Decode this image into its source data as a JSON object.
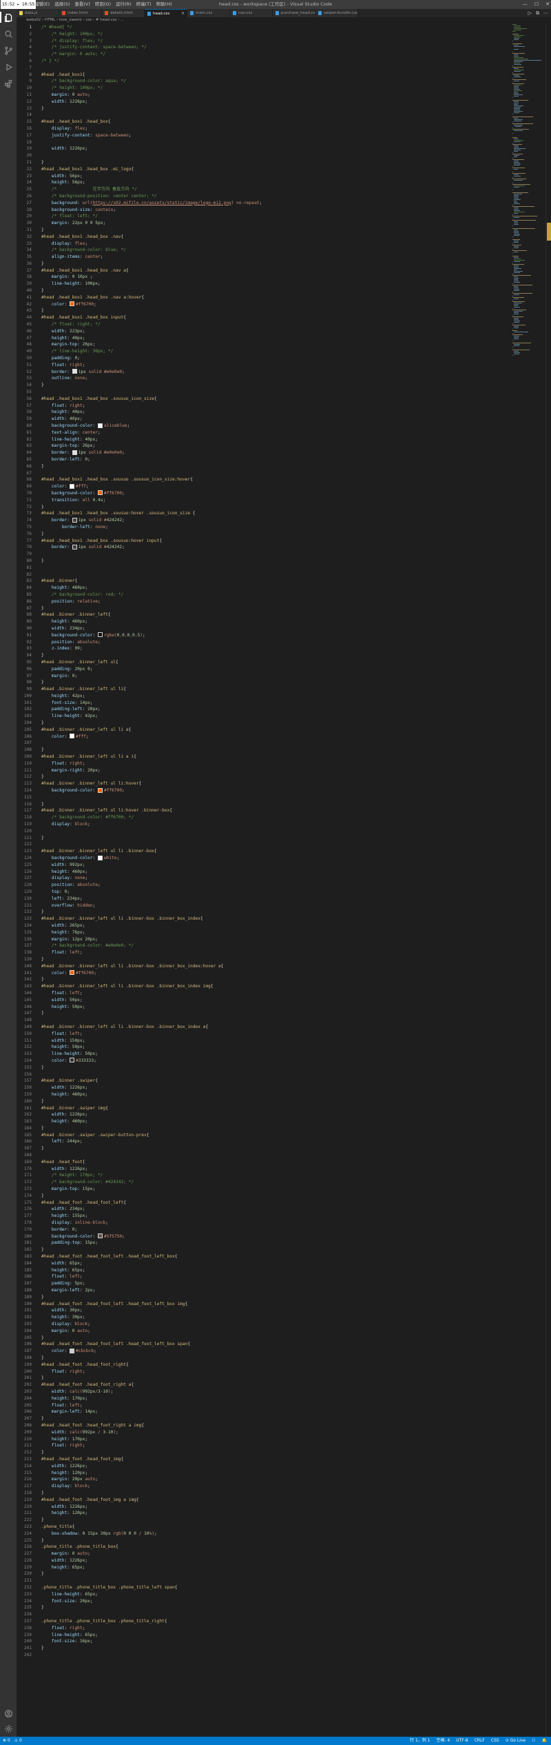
{
  "titlebar": {
    "clock": "15:52 ▸ 10:55",
    "menus": [
      "编辑(E)",
      "选择(S)",
      "查看(V)",
      "转到(G)",
      "运行(R)",
      "终端(T)",
      "帮助(H)"
    ],
    "window_title": "head.css - workspace (工作区) - Visual Studio Code",
    "win_min": "—",
    "win_max": "☐",
    "win_close": "✕"
  },
  "tabs": [
    {
      "label": "data.js",
      "color": "#e8d44d",
      "active": false
    },
    {
      "label": "index.html",
      "color": "#e44d26",
      "active": false
    },
    {
      "label": "details.html",
      "color": "#e44d26",
      "active": false
    },
    {
      "label": "head.css",
      "color": "#3c9ce6",
      "active": true
    },
    {
      "label": "main.css",
      "color": "#3c9ce6",
      "active": false
    },
    {
      "label": "nav.css",
      "color": "#3c9ce6",
      "active": false
    },
    {
      "label": "purchase_head.css",
      "color": "#3c9ce6",
      "active": false
    },
    {
      "label": "swiper-bundle.css",
      "color": "#3c9ce6",
      "active": false
    }
  ],
  "tab_close": "×",
  "editor_actions": [
    "▷",
    "⧉",
    "⋯"
  ],
  "breadcrumb": "webs02 › HTML › love_xiaomi › css › # head.css › ...",
  "status": {
    "left": [
      "⊗ 0",
      "⚠ 0"
    ],
    "right": [
      "行 1，列 1",
      "空格: 4",
      "UTF-8",
      "CRLF",
      "CSS",
      "⊙ Go Live",
      "⚇",
      "🔔"
    ]
  },
  "code_lines": [
    "/* #head{ */",
    "    /* height: 100px; */",
    "    /* display: flex; */",
    "    /* justify-content: space-between; */",
    "    /* margin: 0 auto; */",
    "/* } */",
    "",
    "#head .head_box1{",
    "    /* background-color: aqua; */",
    "    /* height: 100px; */",
    "    margin: 0 auto;",
    "    width: 1226px;",
    "}",
    "",
    "#head .head_box1 .head_box{",
    "    display: flex;",
    "    justify-content: space-between;",
    "",
    "    width: 1226px;",
    "",
    "}",
    "#head .head_box1 .head_box .mi_logo{",
    "    width: 56px;",
    "    height: 56px;",
    "    /*              在字方向 垂直方向 */",
    "    /* background-position: center center; */",
    "    background: url(https://s02.mifile.cn/assets/static/image/logo-mi2.png) no-repeat;",
    "    background-size: contain;",
    "    /* float: left; */",
    "    margin: 22px 0 0 5px;",
    "}",
    "#head .head_box1 .head_box .nav{",
    "    display: flex;",
    "    /* background-color: blue; */",
    "    align-items: center;",
    "}",
    "#head .head_box1 .head_box .nav a{",
    "    margin: 0 10px ;",
    "    line-height: 100px;",
    "}",
    "#head .head_box1 .head_box .nav a:hover{",
    "    color: #ff6700;",
    "}",
    "#head .head_box1 .head_box input{",
    "    /* float: right; */",
    "    width: 223px;",
    "    height: 40px;",
    "    margin-top: 26px;",
    "    /* line-height: 30px; */",
    "    padding: 0;",
    "    float: right;",
    "    border: 1px solid #e0e0e0;",
    "    outline: none;",
    "}",
    "",
    "#head .head_box1 .head_box .sousuo_icon_size{",
    "    float: right;",
    "    height: 40px;",
    "    width: 40px;",
    "    background-color: aliceblue;",
    "    text-align: center;",
    "    line-height: 40px;",
    "    margin-top: 26px;",
    "    border: 1px solid #e0e0e0;",
    "    border-left: 0;",
    "}",
    "",
    "#head .head_box1 .head_box .sousuo .sousuo_icon_size:hover{",
    "    color: #fff;",
    "    background-color: #ff6700;",
    "    transition: all 0.4s;",
    "}",
    "#head .head_box1 .head_box .sousuo:hover .sousuo_icon_size {",
    "    border: 1px solid #424242;",
    "        border-left: none;",
    "}",
    "#head .head_box1 .head_box .sousuo:hover input{",
    "    border: 1px solid #424242;",
    "",
    "}",
    "",
    "",
    "#head .binner{",
    "    height: 460px;",
    "    /* background-color: red; */",
    "    position: relative;",
    "}",
    "#head .binner .binner_left{",
    "    height: 460px;",
    "    width: 234px;",
    "    background-color: rgba(0,0,0,0.5);",
    "    position: absolute;",
    "    z-index: 99;",
    "}",
    "#head .binner .binner_left ul{",
    "    padding: 20px 0;",
    "    margin: 0;",
    "}",
    "#head .binner .binner_left ul li{",
    "    height: 42px;",
    "    font-size: 14px;",
    "    padding-left: 20px;",
    "    line-height: 42px;",
    "}",
    "#head .binner .binner_left ul li a{",
    "    color: #fff;",
    "",
    "}",
    "#head .binner .binner_left ul li a i{",
    "    float: right;",
    "    margin-right: 20px;",
    "}",
    "#head .binner .binner_left ul li:hover{",
    "    background-color: #ff6700;",
    "",
    "}",
    "#head .binner .binner_left ul li:hover .binner-box{",
    "    /* background-color: #ff6700; */",
    "    display: block;",
    "",
    "}",
    "",
    "#head .binner .binner_left ul li .binner-box{",
    "    background-color: white;",
    "    width: 992px;",
    "    height: 460px;",
    "    display: none;",
    "    position: absolute;",
    "    top: 0;",
    "    left: 234px;",
    "    overflow: hidden;",
    "}",
    "#head .binner .binner_left ul li .binner-box .binner_box_index{",
    "    width: 265px;",
    "    height: 76px;",
    "    margin: 12px 20px;",
    "    /* background-color: #e0e0e0; */",
    "    float: left;",
    "}",
    "#head .binner .binner_left ul li .binner-box .binner_box_index:hover a{",
    "    color: #ff6700;",
    "}",
    "#head .binner .binner_left ul li .binner-box .binner_box_index img{",
    "    float: left;",
    "    width: 50px;",
    "    height: 50px;",
    "}",
    "",
    "#head .binner .binner_left ul li .binner-box .binner_box_index a{",
    "    float: left;",
    "    width: 150px;",
    "    height: 50px;",
    "    line-height: 50px;",
    "    color: #333333;",
    "}",
    "",
    "#head .binner .swiper{",
    "    width: 1226px;",
    "    height: 460px;",
    "}",
    "#head .binner .swiper img{",
    "    width: 1226px;",
    "    height: 460px;",
    "}",
    "#head .binner .swiper .swiper-button-prev{",
    "    left: 244px;",
    "}",
    "",
    "#head .head_foot{",
    "    width: 1226px;",
    "    /* height: 170px; */",
    "    /* background-color: #424242; */",
    "    margin-top: 15px;",
    "}",
    "#head .head_foot .head_foot_left{",
    "    width: 234px;",
    "    height: 155px;",
    "    display: inline-block;",
    "    border: 0;",
    "    background-color: #5f5750;",
    "    padding-top: 15px;",
    "}",
    "#head .head_foot .head_foot_left .head_foot_left_box{",
    "    width: 65px;",
    "    height: 65px;",
    "    float: left;",
    "    padding: 5px;",
    "    margin-left: 2px;",
    "}",
    "#head .head_foot .head_foot_left .head_foot_left_box img{",
    "    width: 30px;",
    "    height: 30px;",
    "    display: block;",
    "    margin: 0 auto;",
    "}",
    "#head .head_foot .head_foot_left .head_foot_left_box span{",
    "    color: #cbcbcb;",
    "}",
    "#head .head_foot .head_foot_right{",
    "    float: right;",
    "}",
    "#head .head_foot .head_foot_right a{",
    "    width: calc(992px/3-10);",
    "    height: 170px;",
    "    float: left;",
    "    margin-left: 14px;",
    "}",
    "#head .head_foot .head_foot_right a img{",
    "    width: calc(992px / 3-10);",
    "    height: 170px;",
    "    float: right;",
    "}",
    "#head .head_foot .head_foot_img{",
    "    width: 1226px;",
    "    height: 120px;",
    "    margin: 20px auto;",
    "    display: block;",
    "}",
    "#head .head_foot .head_foot_img a img{",
    "    width: 1226px;",
    "    height: 120px;",
    "}",
    ".phone_title{",
    "    box-shadow: 0 15px 30px rgb(0 0 0 / 10%);",
    "}",
    ".phone_title .phone_title_box{",
    "    margin: 0 auto;",
    "    width: 1226px;",
    "    height: 65px;",
    "}",
    "",
    ".phone_title .phone_title_box .phone_title_left span{",
    "    line-height: 65px;",
    "    font-size: 20px;",
    "}",
    "",
    ".phone_title .phone_title_box .phone_title_right{",
    "    float: right;",
    "    line-height: 65px;",
    "    font-size: 16px;",
    "}",
    ""
  ]
}
